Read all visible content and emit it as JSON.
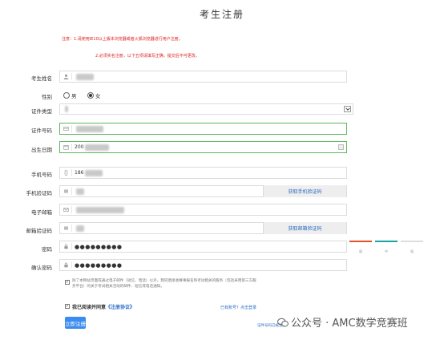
{
  "page": {
    "title": "考生注册"
  },
  "notices": [
    "注意：1.请使用IE10以上版本浏览器或者火狐浏览器进行用户注册。",
    "2.必须实名注册，以下五项请填写正确，提交后不可更改。"
  ],
  "form": {
    "name": {
      "label": "考生姓名",
      "value": ""
    },
    "gender": {
      "label": "性别",
      "options": [
        "男",
        "女"
      ],
      "selected": "女"
    },
    "id_type": {
      "label": "证件类型",
      "value": ""
    },
    "id_number": {
      "label": "证件号码",
      "value": ""
    },
    "birthdate": {
      "label": "出生日期",
      "value": "200"
    },
    "phone": {
      "label": "手机号码",
      "value": "186"
    },
    "sms_code": {
      "label": "手机验证码",
      "value": "",
      "button": "获取手机验证码"
    },
    "email": {
      "label": "电子邮箱",
      "value": ""
    },
    "email_code": {
      "label": "邮箱验证码",
      "value": "",
      "button": "获取邮箱验证码"
    },
    "password": {
      "label": "密码",
      "value": "●●●●●●●●●"
    },
    "confirm_password": {
      "label": "确认密码",
      "value": "●●●●●●●●●"
    }
  },
  "strength": {
    "colors": [
      "#e0522a",
      "#1aa3a3",
      "#dddddd"
    ],
    "labels": [
      "弱",
      "中",
      "强"
    ]
  },
  "consent": {
    "text": "除了本网站页面或通过电子邮件（短信、电话）以外，我同意接收赛事报名和考试相关的服务（包括采用第三方服务平台）的关于考试相关活动的邮件、短信或电话通知。",
    "agree_prefix": "我已阅读并同意",
    "agree_link": "《注册协议》",
    "have_account": "已有账号？点击登录",
    "forgot_link": "证件号码已被注册"
  },
  "submit": {
    "label": "立即注册"
  },
  "watermark": {
    "text": "公众号 · AMC数学竞赛班"
  }
}
